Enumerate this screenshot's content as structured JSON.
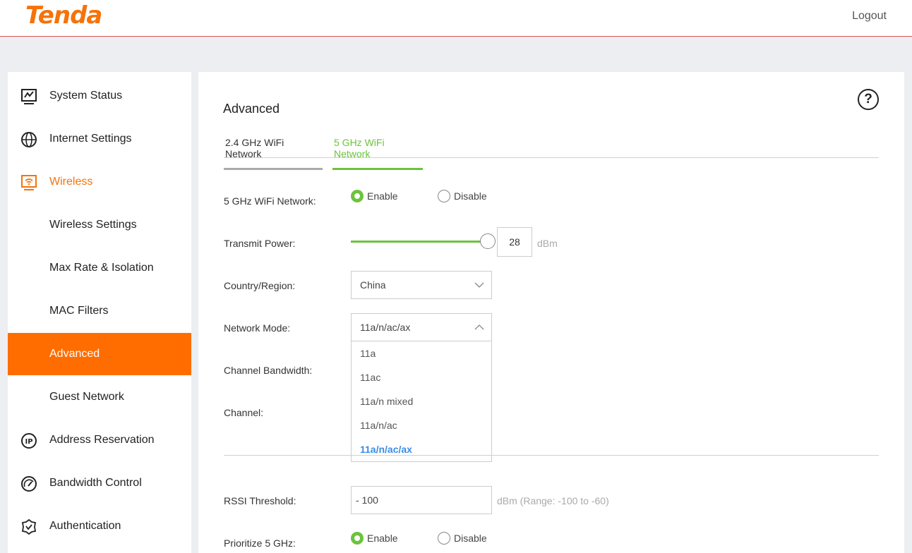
{
  "header": {
    "logo": "Tenda",
    "logout": "Logout"
  },
  "sidebar": {
    "items": [
      {
        "label": "System Status",
        "icon": "monitor-icon"
      },
      {
        "label": "Internet Settings",
        "icon": "globe-icon"
      },
      {
        "label": "Wireless",
        "icon": "wifi-monitor-icon"
      },
      {
        "label": "Wireless Settings"
      },
      {
        "label": "Max Rate & Isolation"
      },
      {
        "label": "MAC Filters"
      },
      {
        "label": "Advanced"
      },
      {
        "label": "Guest Network"
      },
      {
        "label": "Address Reservation",
        "icon": "ip-icon"
      },
      {
        "label": "Bandwidth Control",
        "icon": "gauge-icon"
      },
      {
        "label": "Authentication",
        "icon": "shield-check-icon"
      }
    ]
  },
  "main": {
    "title": "Advanced",
    "help": "?",
    "tabs": [
      {
        "label": "2.4 GHz WiFi Network"
      },
      {
        "label": "5 GHz WiFi Network"
      }
    ],
    "wifi_network": {
      "label": "5 GHz WiFi Network:",
      "enable": "Enable",
      "disable": "Disable"
    },
    "transmit_power": {
      "label": "Transmit Power:",
      "value": "28",
      "unit": "dBm",
      "level": 1.0
    },
    "country": {
      "label": "Country/Region:",
      "value": "China"
    },
    "network_mode": {
      "label": "Network Mode:",
      "value": "11a/n/ac/ax",
      "options": [
        "11a",
        "11ac",
        "11a/n mixed",
        "11a/n/ac",
        "11a/n/ac/ax"
      ]
    },
    "channel_bandwidth": {
      "label": "Channel Bandwidth:"
    },
    "channel": {
      "label": "Channel:"
    },
    "rssi": {
      "label": "RSSI Threshold:",
      "value": "- 100",
      "hint": "dBm (Range: -100 to -60)"
    },
    "prioritize": {
      "label": "Prioritize 5 GHz:",
      "enable": "Enable",
      "disable": "Disable"
    }
  },
  "colors": {
    "accent": "#ff6d00",
    "green": "#6cc33c",
    "selected": "#3a8ee6"
  }
}
